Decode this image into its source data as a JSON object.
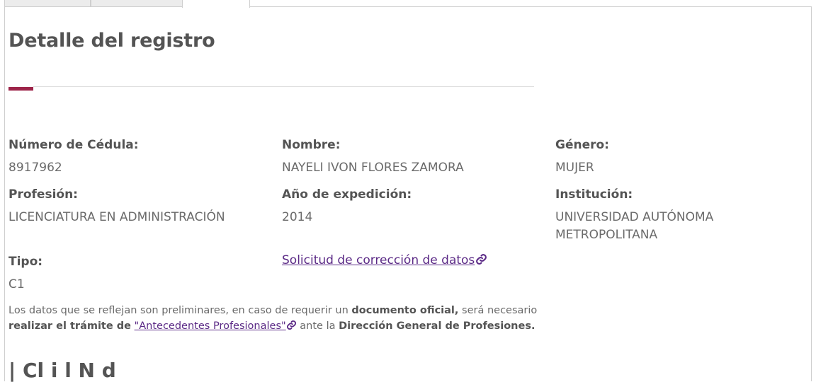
{
  "page": {
    "title": "Detalle del registro"
  },
  "fields": {
    "cedula": {
      "label": "Número de Cédula:",
      "value": "8917962"
    },
    "nombre": {
      "label": "Nombre:",
      "value": "NAYELI IVON FLORES ZAMORA"
    },
    "genero": {
      "label": "Género:",
      "value": "MUJER"
    },
    "profesion": {
      "label": "Profesión:",
      "value": "LICENCIATURA EN ADMINISTRACIÓN"
    },
    "anio": {
      "label": "Año de expedición:",
      "value": "2014"
    },
    "institucion": {
      "label": "Institución:",
      "value": "UNIVERSIDAD AUTÓNOMA METROPOLITANA"
    },
    "tipo": {
      "label": "Tipo:",
      "value": "C1"
    }
  },
  "correction_link": {
    "text": "Solicitud de corrección de datos",
    "icon": "link-icon"
  },
  "note": {
    "part1": "Los datos que se reflejan son preliminares, en caso de requerir un ",
    "bold1": "documento oficial,",
    "part2": " será necesario ",
    "bold2": "realizar el trámite de",
    "link": "\"Antecedentes Profesionales\"",
    "part3": " ante la ",
    "bold3": "Dirección General de Profesiones."
  },
  "next_section": {
    "title": "| Cl   i   l  N       d"
  },
  "colors": {
    "accent": "#9d2449",
    "link": "#5b2a86"
  }
}
